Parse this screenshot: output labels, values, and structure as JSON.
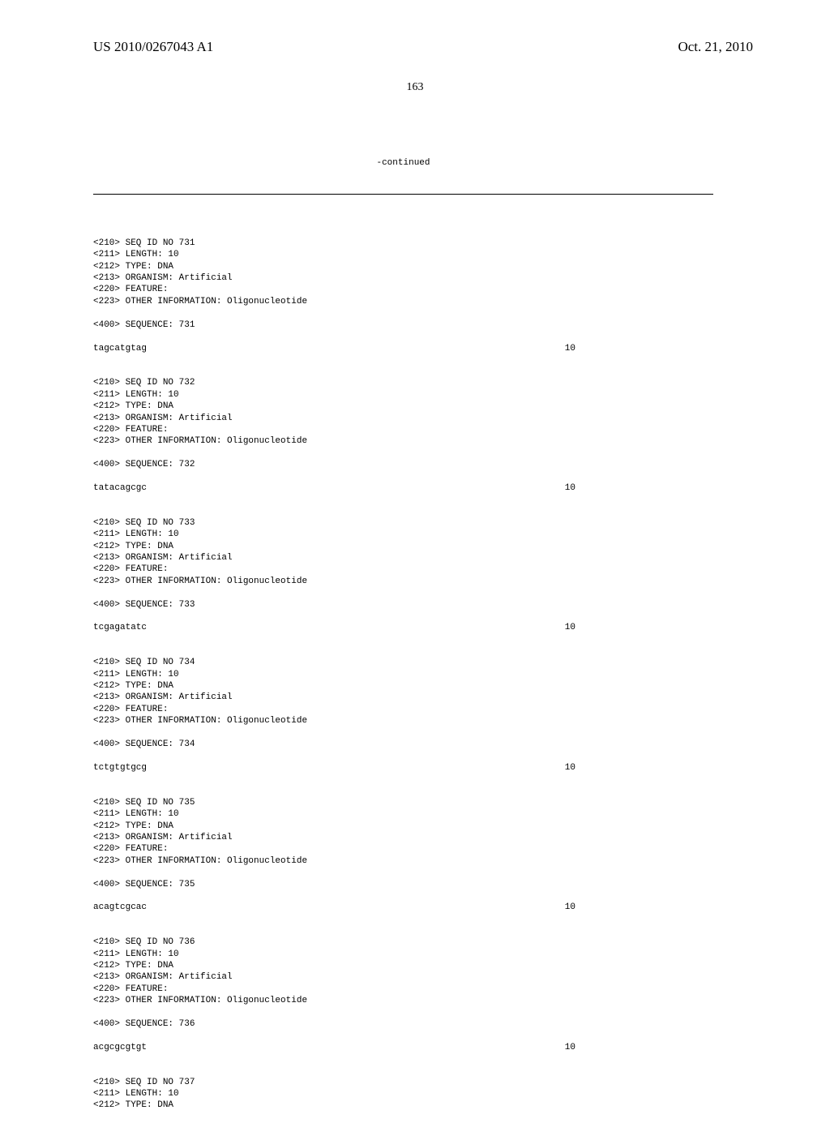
{
  "header": {
    "publication_number": "US 2010/0267043 A1",
    "publication_date": "Oct. 21, 2010"
  },
  "page_number": "163",
  "continued_label": "-continued",
  "sequences": [
    {
      "id": "731",
      "length": "10",
      "type": "DNA",
      "organism": "Artificial",
      "other_info": "Oligonucleotide",
      "sequence_label": "731",
      "sequence": "tagcatgtag",
      "seq_right": "10"
    },
    {
      "id": "732",
      "length": "10",
      "type": "DNA",
      "organism": "Artificial",
      "other_info": "Oligonucleotide",
      "sequence_label": "732",
      "sequence": "tatacagcgc",
      "seq_right": "10"
    },
    {
      "id": "733",
      "length": "10",
      "type": "DNA",
      "organism": "Artificial",
      "other_info": "Oligonucleotide",
      "sequence_label": "733",
      "sequence": "tcgagatatc",
      "seq_right": "10"
    },
    {
      "id": "734",
      "length": "10",
      "type": "DNA",
      "organism": "Artificial",
      "other_info": "Oligonucleotide",
      "sequence_label": "734",
      "sequence": "tctgtgtgcg",
      "seq_right": "10"
    },
    {
      "id": "735",
      "length": "10",
      "type": "DNA",
      "organism": "Artificial",
      "other_info": "Oligonucleotide",
      "sequence_label": "735",
      "sequence": "acagtcgcac",
      "seq_right": "10"
    },
    {
      "id": "736",
      "length": "10",
      "type": "DNA",
      "organism": "Artificial",
      "other_info": "Oligonucleotide",
      "sequence_label": "736",
      "sequence": "acgcgcgtgt",
      "seq_right": "10"
    }
  ],
  "partial": {
    "id": "737",
    "length": "10",
    "type": "DNA"
  },
  "labels": {
    "tag210": "<210> SEQ ID NO ",
    "tag211": "<211> LENGTH: ",
    "tag212": "<212> TYPE: ",
    "tag213": "<213> ORGANISM: ",
    "tag220": "<220> FEATURE:",
    "tag223": "<223> OTHER INFORMATION: ",
    "tag400": "<400> SEQUENCE: "
  }
}
